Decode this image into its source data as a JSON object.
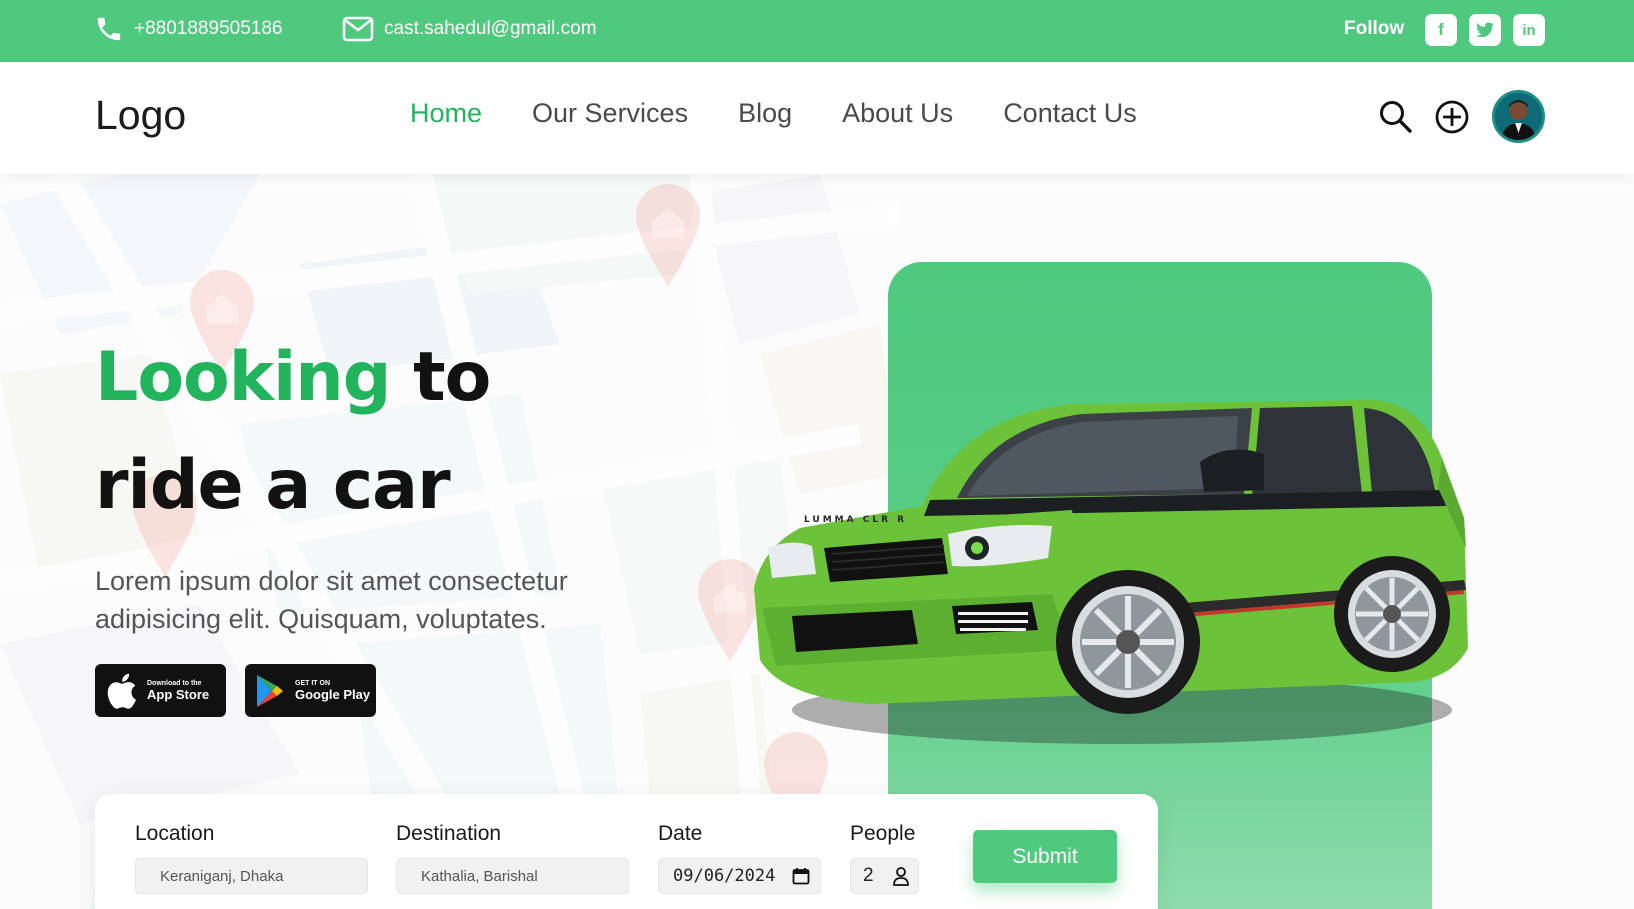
{
  "topbar": {
    "phone": "+8801889505186",
    "email": "cast.sahedul@gmail.com",
    "follow_label": "Follow",
    "social": [
      {
        "icon": "facebook-icon",
        "glyph": "f"
      },
      {
        "icon": "twitter-icon",
        "glyph": "🐦"
      },
      {
        "icon": "linkedin-icon",
        "glyph": "in"
      }
    ]
  },
  "nav": {
    "logo": "Logo",
    "links": [
      "Home",
      "Our Services",
      "Blog",
      "About Us",
      "Contact Us"
    ],
    "active": "Home",
    "icons": [
      "search-icon",
      "add-circle-icon",
      "user-avatar"
    ]
  },
  "hero": {
    "title_highlight": "Looking",
    "title_rest_1": "to",
    "title_line_2": "ride a car",
    "description": "Lorem ipsum dolor sit amet consectetur adipisicing elit. Quisquam, voluptates.",
    "app_store": {
      "small": "Download to the",
      "big": "App Store"
    },
    "google_play": {
      "small": "GET IT ON",
      "big": "Google Play"
    },
    "car_plate": "LUMMA CLR R"
  },
  "booking": {
    "location": {
      "label": "Location",
      "value": "Keraniganj, Dhaka"
    },
    "destination": {
      "label": "Destination",
      "value": "Kathalia, Barishal"
    },
    "date": {
      "label": "Date",
      "value": "09/06/2024"
    },
    "people": {
      "label": "People",
      "value": "2"
    },
    "submit_label": "Submit"
  },
  "colors": {
    "accent": "#4ec97e",
    "accent_text": "#22b35d",
    "car_body": "#6cc33a"
  }
}
